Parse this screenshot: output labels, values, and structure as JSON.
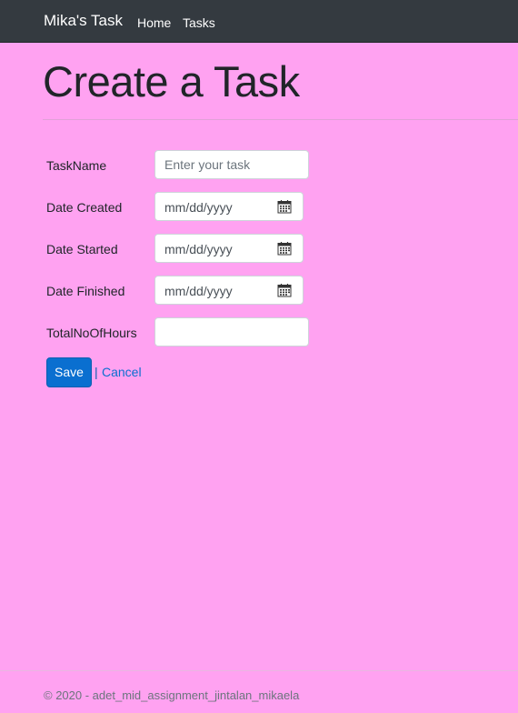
{
  "navbar": {
    "brand": "Mika's Task",
    "links": [
      {
        "label": "Home"
      },
      {
        "label": "Tasks"
      }
    ]
  },
  "page": {
    "title": "Create a Task"
  },
  "form": {
    "task_name": {
      "label": "TaskName",
      "placeholder": "Enter your task",
      "value": ""
    },
    "date_created": {
      "label": "Date Created",
      "placeholder": "mm/dd/yyyy"
    },
    "date_started": {
      "label": "Date Started",
      "placeholder": "mm/dd/yyyy"
    },
    "date_finished": {
      "label": "Date Finished",
      "placeholder": "mm/dd/yyyy"
    },
    "total_hours": {
      "label": "TotalNoOfHours",
      "value": ""
    },
    "save_label": "Save",
    "separator": "|",
    "cancel_label": "Cancel"
  },
  "footer": {
    "text": "© 2020 - adet_mid_assignment_jintalan_mikaela"
  },
  "icons": {
    "calendar": "calendar-icon"
  },
  "colors": {
    "page_background": "#ffa2f1",
    "navbar_background": "#343a40",
    "primary": "#0a6fd0"
  }
}
